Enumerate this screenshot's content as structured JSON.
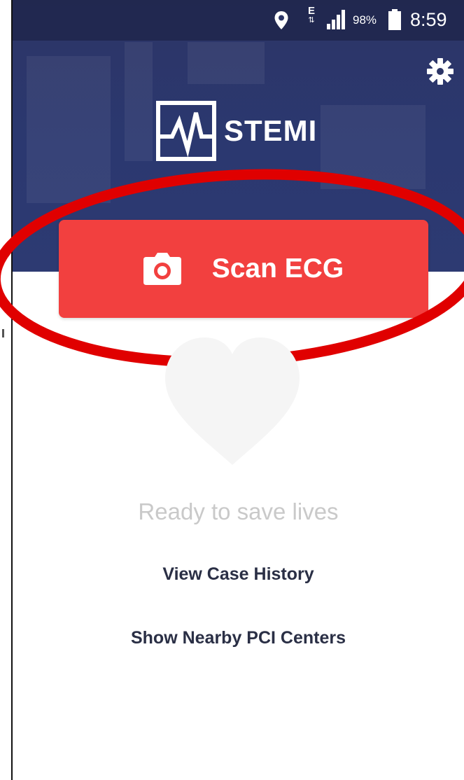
{
  "status_bar": {
    "network_type": "E",
    "battery_percent": "98%",
    "time": "8:59",
    "icons": [
      "location-pin-icon",
      "network-type-icon",
      "signal-icon",
      "battery-icon"
    ]
  },
  "header": {
    "logo_text": "STEMI",
    "settings_icon": "gear-icon"
  },
  "scan_button": {
    "label": "Scan ECG",
    "icon": "camera-icon"
  },
  "main": {
    "status_text": "Ready to save lives",
    "status_icon": "heart-icon"
  },
  "links": {
    "case_history": "View Case History",
    "pci_centers": "Show Nearby PCI Centers"
  },
  "colors": {
    "header_bg": "#2b3870",
    "accent_red": "#f2403f",
    "annotation_red": "#e00000",
    "muted_text": "#c9c9c9",
    "link_text": "#2a2f45",
    "heart_fill": "#f5f5f5"
  }
}
